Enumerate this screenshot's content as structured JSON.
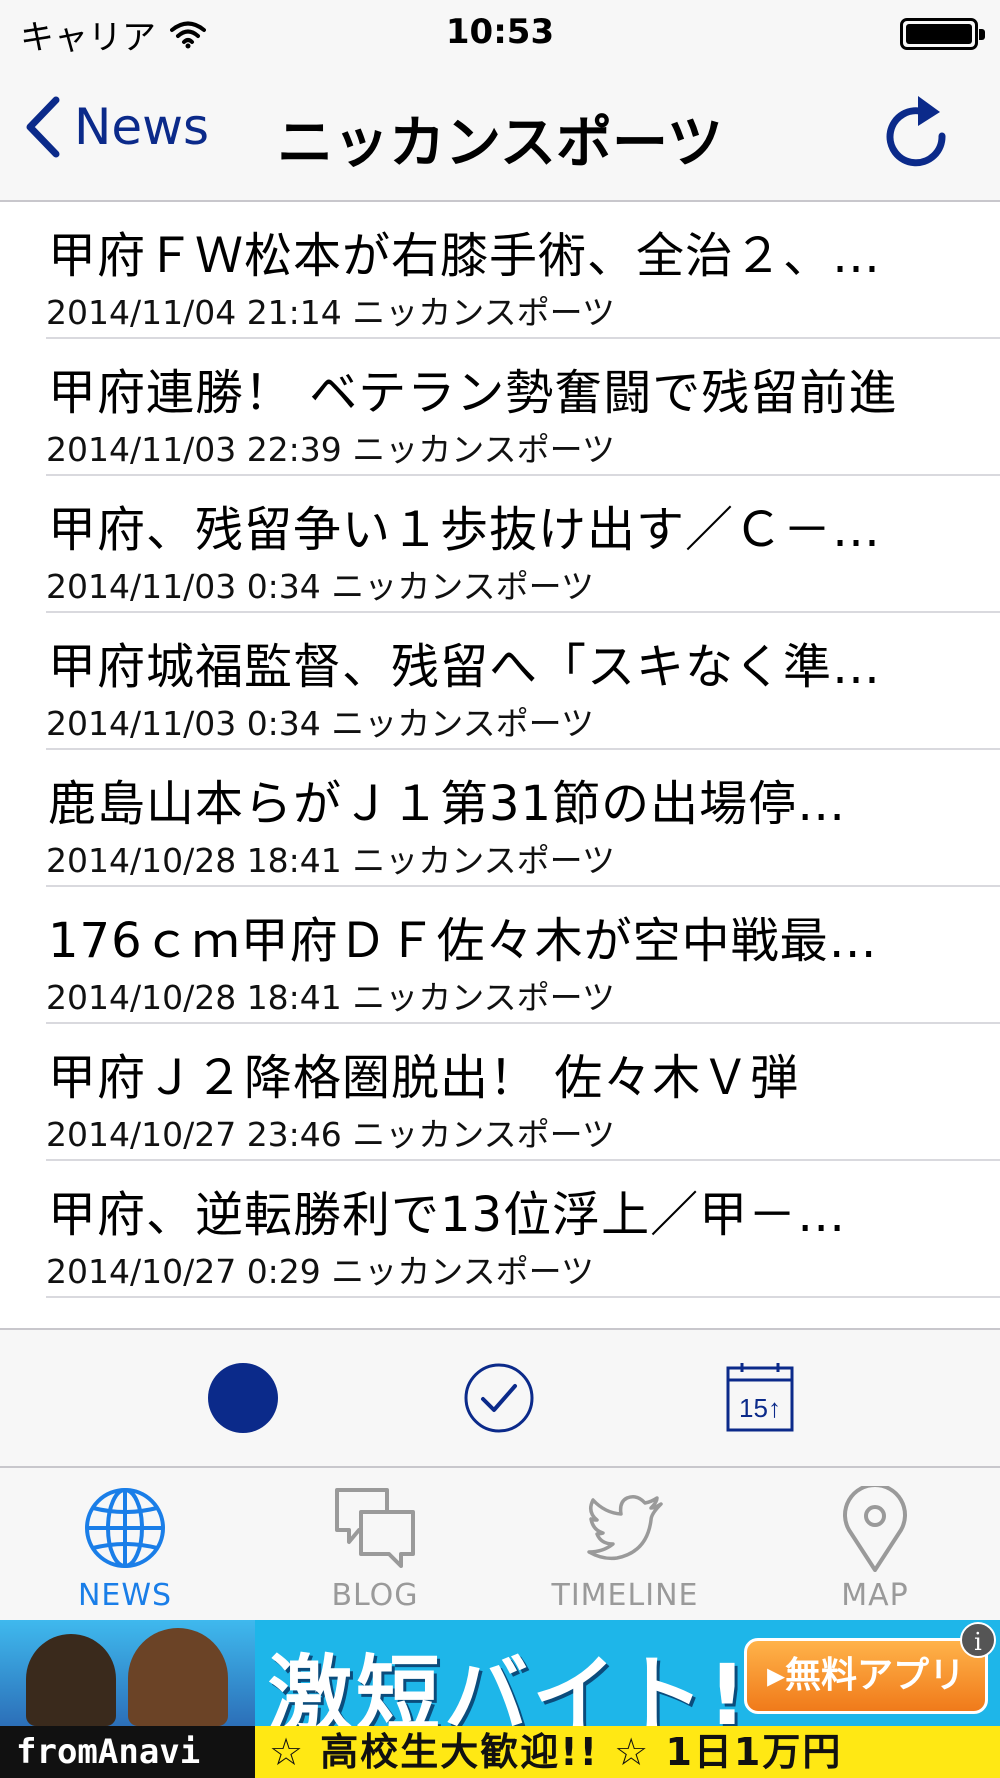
{
  "status_bar": {
    "carrier": "キャリア",
    "time": "10:53"
  },
  "nav": {
    "back_label": "News",
    "title": "ニッカンスポーツ"
  },
  "articles": [
    {
      "title": "甲府ＦＷ松本が右膝手術、全治２、…",
      "meta": "2014/11/04 21:14 ニッカンスポーツ"
    },
    {
      "title": "甲府連勝！ ベテラン勢奮闘で残留前進",
      "meta": "2014/11/03 22:39 ニッカンスポーツ"
    },
    {
      "title": "甲府、残留争い１歩抜け出す／Ｃ－…",
      "meta": "2014/11/03 0:34 ニッカンスポーツ"
    },
    {
      "title": "甲府城福監督、残留へ「スキなく準…",
      "meta": "2014/11/03 0:34 ニッカンスポーツ"
    },
    {
      "title": "鹿島山本らがＪ１第31節の出場停…",
      "meta": "2014/10/28 18:41 ニッカンスポーツ"
    },
    {
      "title": "176ｃｍ甲府ＤＦ佐々木が空中戦最…",
      "meta": "2014/10/28 18:41 ニッカンスポーツ"
    },
    {
      "title": "甲府Ｊ２降格圏脱出！ 佐々木Ｖ弾",
      "meta": "2014/10/27 23:46 ニッカンスポーツ"
    },
    {
      "title": "甲府、逆転勝利で13位浮上／甲－…",
      "meta": "2014/10/27 0:29 ニッカンスポーツ"
    }
  ],
  "toolbar": {
    "calendar_label": "15↑"
  },
  "tabs": [
    {
      "label": "NEWS",
      "icon": "globe-icon",
      "active": true
    },
    {
      "label": "BLOG",
      "icon": "speech-bubbles-icon",
      "active": false
    },
    {
      "label": "TIMELINE",
      "icon": "bird-icon",
      "active": false
    },
    {
      "label": "MAP",
      "icon": "map-pin-icon",
      "active": false
    }
  ],
  "ad": {
    "headline": "激短バイト!",
    "cta": "▸無料アプリ",
    "logo": "fromAnavi",
    "tagline": "☆ 高校生大歓迎!! ☆ 1日1万円",
    "info": "i"
  },
  "colors": {
    "accent": "#0b2a8a",
    "tab_active": "#1a7ee8",
    "tab_inactive": "#9a9a9a"
  }
}
